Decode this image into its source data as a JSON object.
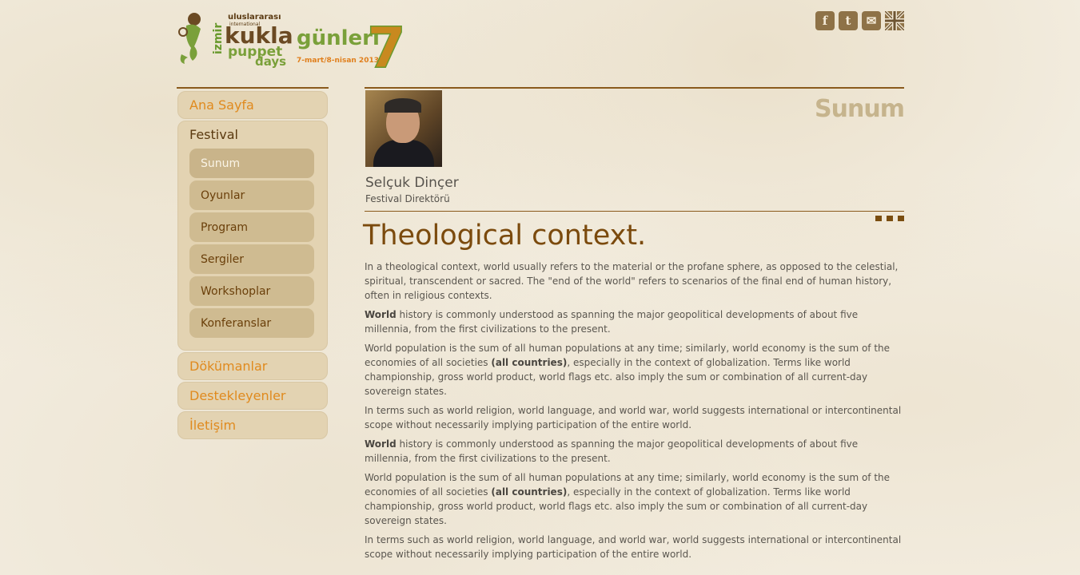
{
  "logo": {
    "city": "izmir",
    "line1": "uluslararası",
    "line2": "international",
    "kukla": "kukla",
    "gunleri": "günleri",
    "puppet": "puppet",
    "days": "days",
    "dates": "7-mart/8-nisan 2013",
    "number": "7"
  },
  "social": [
    {
      "name": "facebook",
      "glyph": "f"
    },
    {
      "name": "twitter",
      "glyph": "t"
    },
    {
      "name": "email",
      "glyph": "✉"
    },
    {
      "name": "english",
      "glyph": ""
    }
  ],
  "nav": {
    "home": "Ana Sayfa",
    "festival": "Festival",
    "festival_items": [
      "Sunum",
      "Oyunlar",
      "Program",
      "Sergiler",
      "Workshoplar",
      "Konferanslar"
    ],
    "documents": "Dökümanlar",
    "supporters": "Destekleyenler",
    "contact": "İletişim"
  },
  "profile": {
    "name": "Selçuk Dinçer",
    "role": "Festival Direktörü",
    "section_title": "Sunum"
  },
  "article": {
    "title": "Theological context.",
    "p1": "In a theological context, world usually refers to the material or the profane sphere, as opposed to the celestial, spiritual, transcendent or sacred. The \"end of the world\" refers to scenarios of the final end of human history, often in religious contexts.",
    "p2_bold": "World",
    "p2_rest": " history is commonly understood as spanning the major geopolitical developments of about five millennia, from the first civilizations to the present.",
    "p3_a": "World population is the sum of all human populations at any time; similarly, world economy is the sum of the economies of all societies ",
    "p3_bold": "(all countries)",
    "p3_b": ", especially in the context of globalization. Terms like world championship, gross world product, world flags etc. also imply the sum or combination of all current-day sovereign states.",
    "p4": "In terms such as world religion, world language, and world war, world suggests international or intercontinental scope without necessarily implying participation of the entire world.",
    "p5_bold": "World",
    "p5_rest": " history is commonly understood as spanning the major geopolitical developments of about five millennia, from the first civilizations to the present.",
    "p6_a": "World population is the sum of all human populations at any time; similarly, world economy is the sum of the economies of all societies ",
    "p6_bold": "(all countries)",
    "p6_b": ", especially in the context of globalization. Terms like world championship, gross world product, world flags etc. also imply the sum or combination of all current-day sovereign states.",
    "p7": "In terms such as world religion, world language, and world war, world suggests international or intercontinental scope without necessarily implying participation of the entire world."
  }
}
